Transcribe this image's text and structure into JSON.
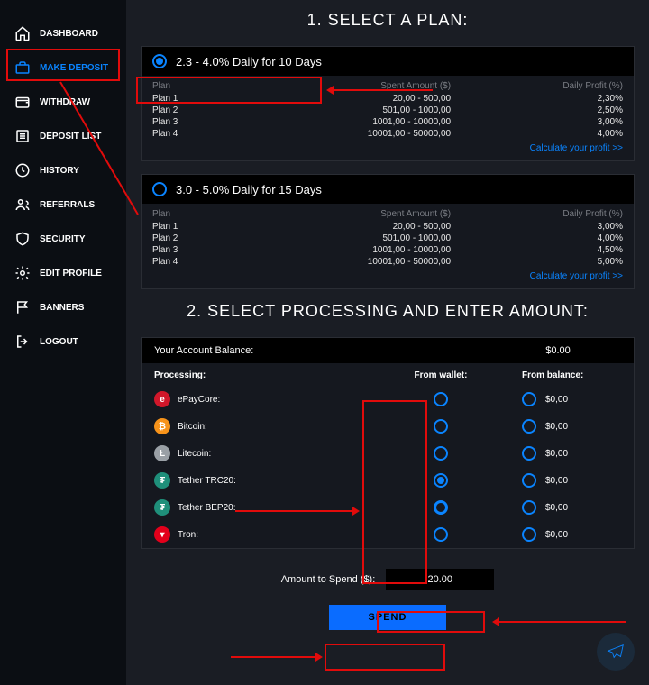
{
  "sidebar": {
    "items": [
      {
        "label": "DASHBOARD"
      },
      {
        "label": "MAKE DEPOSIT"
      },
      {
        "label": "WITHDRAW"
      },
      {
        "label": "DEPOSIT LIST"
      },
      {
        "label": "HISTORY"
      },
      {
        "label": "REFERRALS"
      },
      {
        "label": "SECURITY"
      },
      {
        "label": "EDIT PROFILE"
      },
      {
        "label": "BANNERS"
      },
      {
        "label": "LOGOUT"
      }
    ]
  },
  "section1": {
    "title": "1. SELECT A PLAN:",
    "headers": {
      "plan": "Plan",
      "spent": "Spent Amount ($)",
      "profit": "Daily Profit (%)"
    },
    "calc": "Calculate your profit >>",
    "plan_a": {
      "title": "2.3 - 4.0% Daily for 10 Days",
      "rows": [
        {
          "name": "Plan 1",
          "amount": "20,00 - 500,00",
          "profit": "2,30%"
        },
        {
          "name": "Plan 2",
          "amount": "501,00 - 1000,00",
          "profit": "2,50%"
        },
        {
          "name": "Plan 3",
          "amount": "1001,00 - 10000,00",
          "profit": "3,00%"
        },
        {
          "name": "Plan 4",
          "amount": "10001,00 - 50000,00",
          "profit": "4,00%"
        }
      ]
    },
    "plan_b": {
      "title": "3.0 - 5.0% Daily for 15 Days",
      "rows": [
        {
          "name": "Plan 1",
          "amount": "20,00 - 500,00",
          "profit": "3,00%"
        },
        {
          "name": "Plan 2",
          "amount": "501,00 - 1000,00",
          "profit": "4,00%"
        },
        {
          "name": "Plan 3",
          "amount": "1001,00 - 10000,00",
          "profit": "4,50%"
        },
        {
          "name": "Plan 4",
          "amount": "10001,00 - 50000,00",
          "profit": "5,00%"
        }
      ]
    }
  },
  "section2": {
    "title": "2. SELECT PROCESSING AND ENTER AMOUNT:",
    "balance_label": "Your Account Balance:",
    "balance_value": "$0.00",
    "headers": {
      "proc": "Processing:",
      "wallet": "From wallet:",
      "bal": "From balance:"
    },
    "rows": [
      {
        "name": "ePayCore:",
        "bg": "#d1172a",
        "sym": "e",
        "bal": "$0,00"
      },
      {
        "name": "Bitcoin:",
        "bg": "#f7931a",
        "sym": "₿",
        "bal": "$0,00"
      },
      {
        "name": "Litecoin:",
        "bg": "#9aa0a6",
        "sym": "Ł",
        "bal": "$0,00"
      },
      {
        "name": "Tether TRC20:",
        "bg": "#1f8f7a",
        "sym": "₮",
        "bal": "$0,00"
      },
      {
        "name": "Tether BEP20:",
        "bg": "#1f8f7a",
        "sym": "₮",
        "bal": "$0,00"
      },
      {
        "name": "Tron:",
        "bg": "#e3001b",
        "sym": "▾",
        "bal": "$0,00"
      }
    ],
    "amount_label": "Amount to Spend ($):",
    "amount_value": "20.00",
    "spend_label": "SPEND"
  }
}
